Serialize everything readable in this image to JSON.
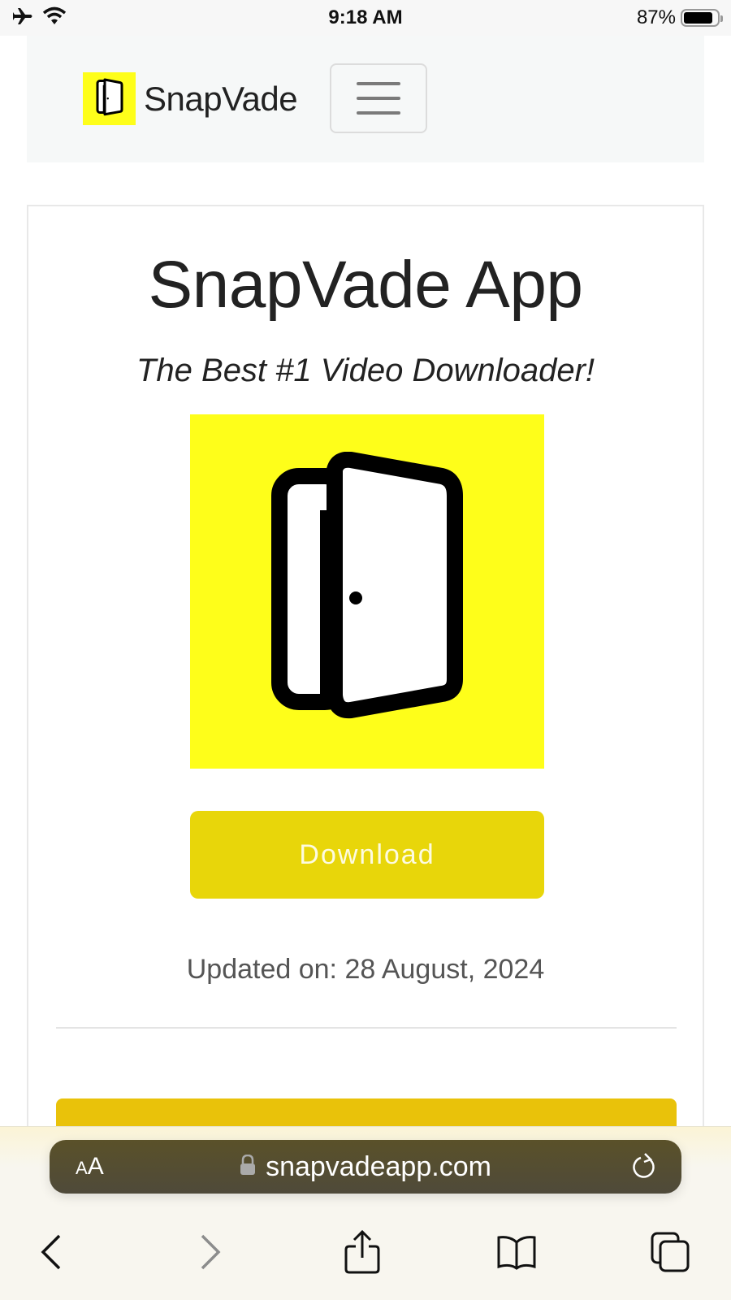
{
  "status_bar": {
    "time": "9:18 AM",
    "battery_percent_label": "87%",
    "battery_level": 0.87,
    "icons": [
      "airplane-mode-icon",
      "wifi-icon",
      "battery-icon"
    ]
  },
  "navbar": {
    "brand_name": "SnapVade",
    "brand_logo_icon": "door-icon",
    "menu_icon": "hamburger-menu-icon"
  },
  "main": {
    "title": "SnapVade App",
    "subtitle": "The Best #1 Video Downloader!",
    "app_icon": "door-icon",
    "download_label": "Download",
    "updated_text": "Updated on: 28 August, 2024"
  },
  "colors": {
    "brand_yellow": "#fefe1a",
    "button_yellow": "#e8d60a",
    "bar_yellow": "#e9c20a",
    "url_bar": "#544d30"
  },
  "browser": {
    "aa_label_small": "A",
    "aa_label_large": "A",
    "url": "snapvadeapp.com",
    "toolbar": [
      "back-icon",
      "forward-icon",
      "share-icon",
      "bookmarks-icon",
      "tabs-icon"
    ]
  }
}
